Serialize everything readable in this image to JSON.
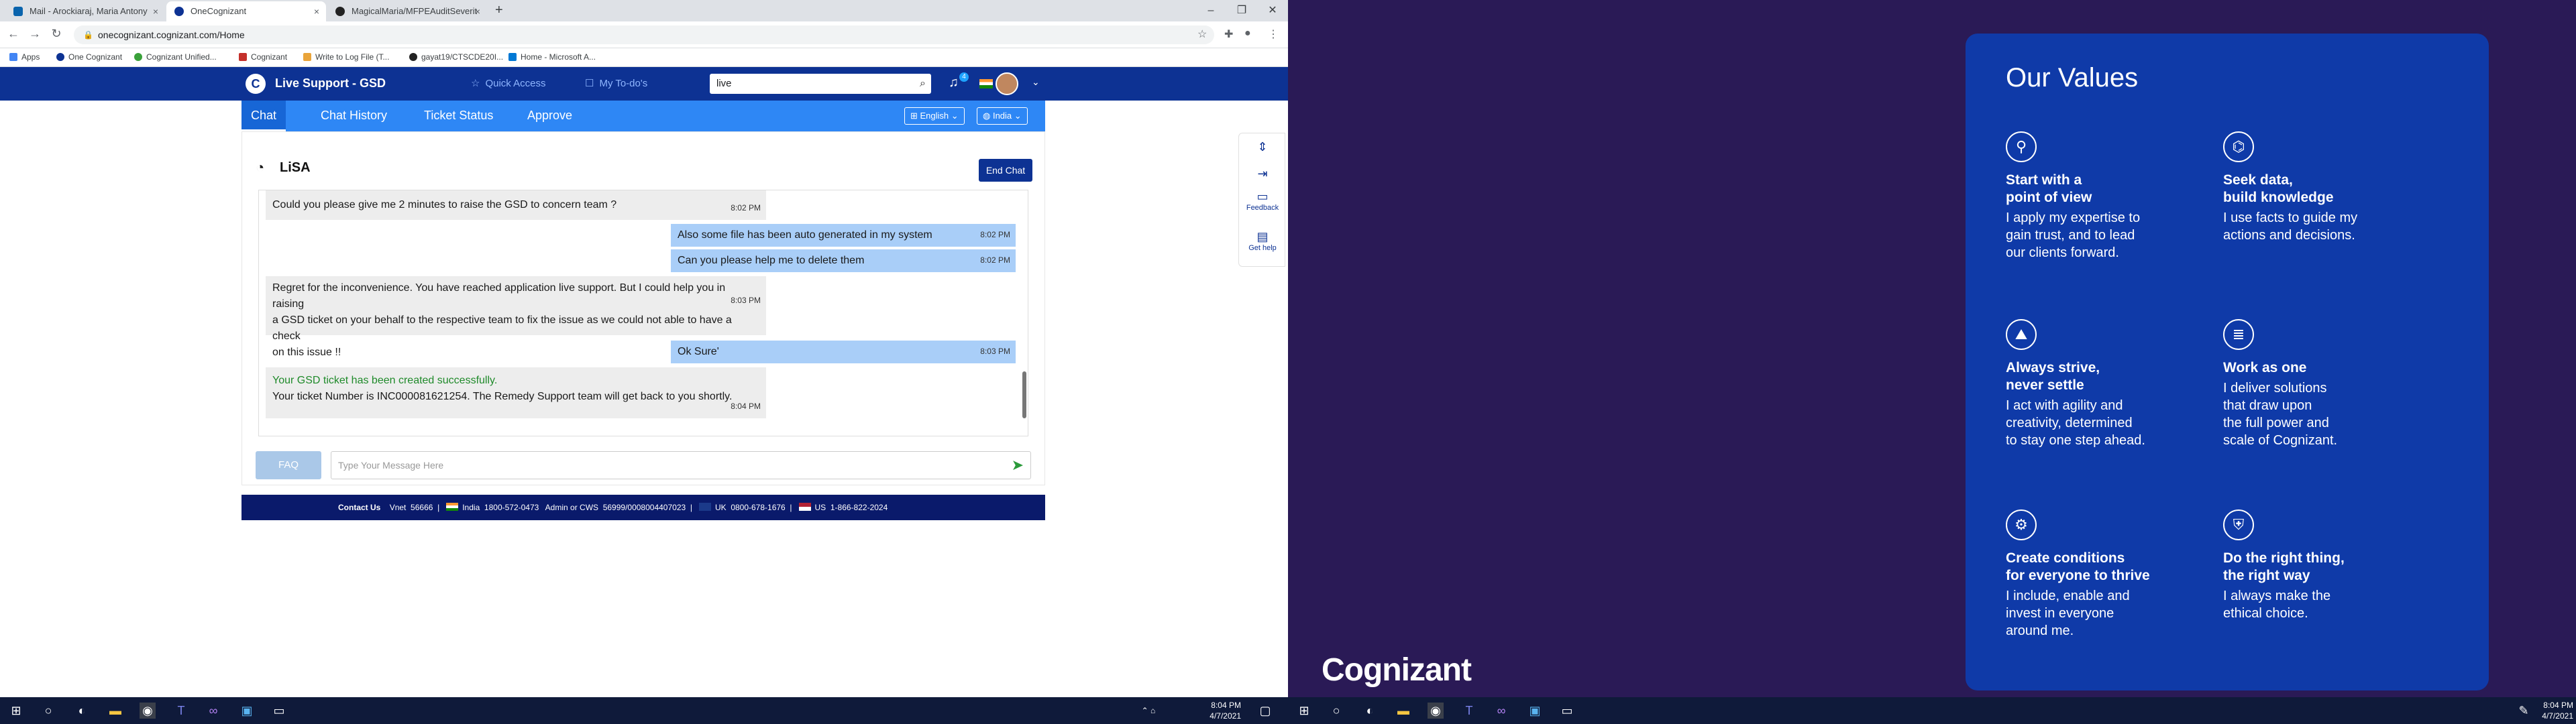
{
  "browser": {
    "tabs": [
      {
        "title": "Mail - Arockiaraj, Maria Antony",
        "active": false
      },
      {
        "title": "OneCognizant",
        "active": true
      },
      {
        "title": "MagicalMaria/MFPEAuditSeverit",
        "active": false
      }
    ],
    "url": "onecognizant.cognizant.com/Home",
    "bookmarks": [
      "Apps",
      "One Cognizant",
      "Cognizant Unified...",
      "Cognizant",
      "Write to Log File (T...",
      "gayat19/CTSCDE20I...",
      "Home - Microsoft A..."
    ]
  },
  "app": {
    "title": "Live Support - GSD",
    "quick_access": "Quick Access",
    "my_todos": "My To-do's",
    "search_value": "live",
    "notification_count": "4"
  },
  "subnav": {
    "tabs": [
      "Chat",
      "Chat History",
      "Ticket Status",
      "Approve"
    ],
    "language": "English",
    "region": "India"
  },
  "chat": {
    "agent_name": "LiSA",
    "end_chat_label": "End Chat",
    "messages": [
      {
        "from": "bot",
        "lines": [
          "Could you please give me 2 minutes to raise the GSD to concern team ?"
        ],
        "time": "8:02 PM"
      },
      {
        "from": "user",
        "lines": [
          "Also some file has been auto generated in my system"
        ],
        "time": "8:02 PM"
      },
      {
        "from": "user",
        "lines": [
          "Can you please help me to delete them"
        ],
        "time": "8:02 PM"
      },
      {
        "from": "bot",
        "lines": [
          "Regret for the inconvenience. You have reached application live support. But I could help you in raising",
          "a GSD ticket on your behalf to the respective team to fix the issue as we could not able to have a check",
          "on this issue !!"
        ],
        "time": "8:03 PM"
      },
      {
        "from": "user",
        "lines": [
          "Ok Sure'"
        ],
        "time": "8:03 PM"
      },
      {
        "from": "bot",
        "lines": [
          "Your GSD ticket has been created successfully.",
          "Your ticket Number is INC000081621254. The Remedy Support team will get back to you shortly."
        ],
        "time": "8:04 PM"
      }
    ],
    "faq_label": "FAQ",
    "input_placeholder": "Type Your Message Here"
  },
  "footer": {
    "contact_us": "Contact Us",
    "vnet_label": "Vnet",
    "vnet": "56666",
    "india_label": "India",
    "india": "1800-572-0473",
    "admin_label": "Admin or CWS",
    "admin": "56999/0008004407023",
    "uk_label": "UK",
    "uk": "0800-678-1676",
    "us_label": "US",
    "us": "1-866-822-2024"
  },
  "widget": {
    "feedback": "Feedback",
    "get_help": "Get help"
  },
  "taskbar": {
    "left_time": "8:04 PM",
    "left_date": "4/7/2021",
    "right_time": "8:04 PM",
    "right_date": "4/7/2021"
  },
  "values_card": {
    "heading": "Our Values",
    "items": [
      {
        "icon": "compass-icon",
        "title": [
          "Start with a",
          "point of view"
        ],
        "text": [
          "I apply my expertise to",
          "gain trust, and to lead",
          "our clients forward."
        ]
      },
      {
        "icon": "data-icon",
        "title": [
          "Seek data,",
          "build knowledge"
        ],
        "text": [
          "I use facts to guide my",
          "actions and decisions."
        ]
      },
      {
        "icon": "mountain-icon",
        "title": [
          "Always strive,",
          "never settle"
        ],
        "text": [
          "I act with agility and",
          "creativity, determined",
          "to stay one step ahead."
        ]
      },
      {
        "icon": "stack-icon",
        "title": [
          "Work as one"
        ],
        "text": [
          "I deliver solutions",
          "that draw upon",
          "the full power and",
          "scale of Cognizant."
        ]
      },
      {
        "icon": "gear-icon",
        "title": [
          "Create conditions",
          "for everyone to thrive"
        ],
        "text": [
          "I include, enable and",
          "invest in everyone",
          "around me."
        ]
      },
      {
        "icon": "shield-icon",
        "title": [
          "Do the right thing,",
          "the right way"
        ],
        "text": [
          "I always make the",
          "ethical choice."
        ]
      }
    ]
  },
  "brand": "Cognizant"
}
